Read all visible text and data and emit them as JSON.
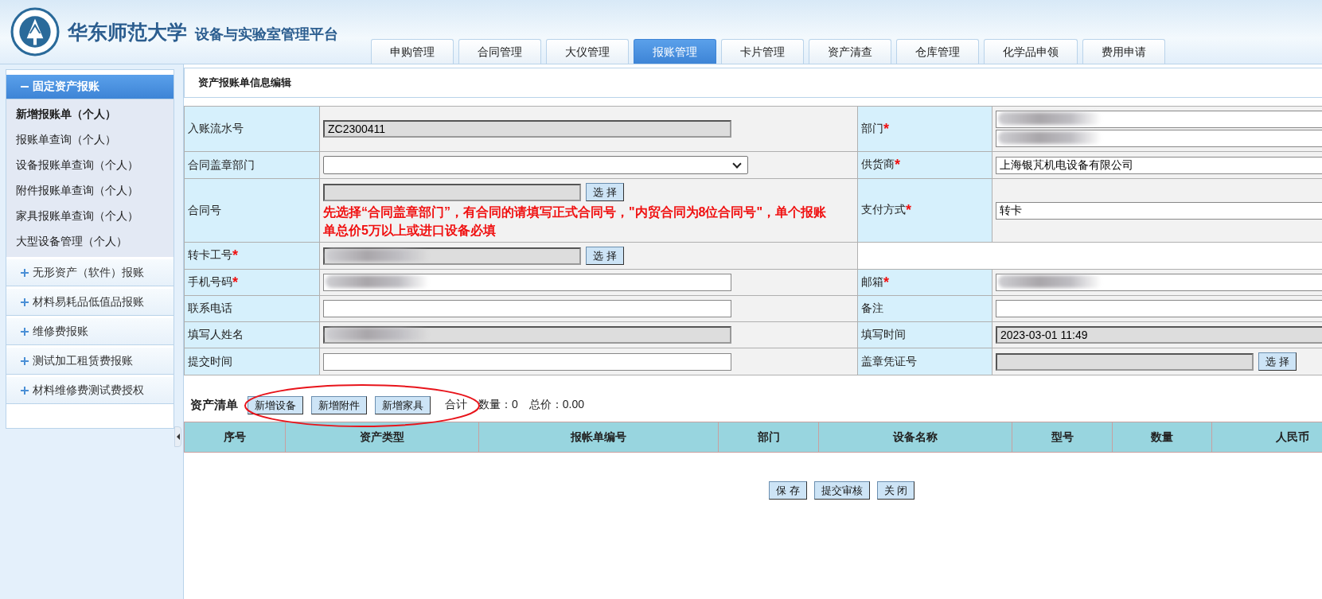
{
  "header": {
    "title": "华东师范大学",
    "subtitle": "设备与实验室管理平台"
  },
  "tabs": [
    {
      "label": "申购管理",
      "selected": false
    },
    {
      "label": "合同管理",
      "selected": false
    },
    {
      "label": "大仪管理",
      "selected": false
    },
    {
      "label": "报账管理",
      "selected": true
    },
    {
      "label": "卡片管理",
      "selected": false
    },
    {
      "label": "资产清查",
      "selected": false
    },
    {
      "label": "仓库管理",
      "selected": false
    },
    {
      "label": "化学品申领",
      "selected": false
    },
    {
      "label": "费用申请",
      "selected": false
    }
  ],
  "sidebar": {
    "groups": [
      {
        "label": "固定资产报账",
        "expanded": true,
        "items": [
          {
            "label": "新增报账单（个人）",
            "selected": true
          },
          {
            "label": "报账单查询（个人）",
            "selected": false
          },
          {
            "label": "设备报账单查询（个人）",
            "selected": false
          },
          {
            "label": "附件报账单查询（个人）",
            "selected": false
          },
          {
            "label": "家具报账单查询（个人）",
            "selected": false
          },
          {
            "label": "大型设备管理（个人）",
            "selected": false
          }
        ]
      },
      {
        "label": "无形资产（软件）报账",
        "expanded": false
      },
      {
        "label": "材料易耗品低值品报账",
        "expanded": false
      },
      {
        "label": "维修费报账",
        "expanded": false
      },
      {
        "label": "测试加工租赁费报账",
        "expanded": false
      },
      {
        "label": "材料维修费测试费授权",
        "expanded": false
      }
    ]
  },
  "panel_title": "资产报账单信息编辑",
  "form": {
    "rows": [
      {
        "cells": [
          {
            "label": "入账流水号",
            "controls": [
              {
                "kind": "input",
                "value": "ZC2300411",
                "readonly": true
              }
            ]
          },
          {
            "label": "部门",
            "mark": "*",
            "controls": [
              {
                "kind": "input",
                "redacted": true,
                "readonly": false
              },
              {
                "kind": "input",
                "redacted": true,
                "readonly": false
              }
            ]
          }
        ]
      },
      {
        "cells": [
          {
            "label": "合同盖章部门",
            "controls": [
              {
                "kind": "select"
              }
            ]
          },
          {
            "label": "供货商",
            "mark": "*",
            "controls": [
              {
                "kind": "input",
                "value": "上海银芃机电设备有限公司",
                "readonly": false
              }
            ]
          }
        ]
      },
      {
        "cells": [
          {
            "label": "合同号",
            "controls": [
              {
                "kind": "input",
                "readonly": true
              },
              {
                "kind": "button",
                "label": "选 择"
              },
              {
                "kind": "note",
                "text": "先选择“合同盖章部门”，有合同的请填写正式合同号，\"内贸合同为8位合同号\"，单个报账单总价5万以上或进口设备必填"
              }
            ]
          },
          {
            "label": "支付方式",
            "mark": "*",
            "controls": [
              {
                "kind": "input",
                "value": "转卡",
                "readonly": false
              }
            ]
          }
        ]
      },
      {
        "cells": [
          {
            "label": "转卡工号",
            "mark": "*",
            "controls": [
              {
                "kind": "input",
                "redacted": true,
                "readonly": true
              },
              {
                "kind": "button",
                "label": "选 择"
              }
            ]
          },
          {
            "kind": "blank"
          }
        ]
      },
      {
        "cells": [
          {
            "label": "手机号码",
            "mark": "*",
            "controls": [
              {
                "kind": "input",
                "redacted": true,
                "readonly": false
              }
            ]
          },
          {
            "label": "邮箱",
            "mark": "*",
            "controls": [
              {
                "kind": "input",
                "redacted": true,
                "readonly": false
              }
            ]
          }
        ]
      },
      {
        "cells": [
          {
            "label": "联系电话",
            "controls": [
              {
                "kind": "input",
                "readonly": false
              }
            ]
          },
          {
            "label": "备注",
            "controls": [
              {
                "kind": "input",
                "readonly": false
              }
            ]
          }
        ]
      },
      {
        "cells": [
          {
            "label": "填写人姓名",
            "controls": [
              {
                "kind": "input",
                "redacted": true,
                "readonly": true
              }
            ]
          },
          {
            "label": "填写时间",
            "controls": [
              {
                "kind": "input",
                "value": "2023-03-01 11:49",
                "readonly": true
              }
            ]
          }
        ]
      },
      {
        "cells": [
          {
            "label": "提交时间",
            "controls": [
              {
                "kind": "input",
                "readonly": false
              }
            ]
          },
          {
            "label": "盖章凭证号",
            "controls": [
              {
                "kind": "input",
                "readonly": true
              },
              {
                "kind": "button",
                "label": "选 择"
              }
            ]
          }
        ]
      }
    ]
  },
  "asset_list": {
    "title": "资产清单",
    "buttons": [
      "新增设备",
      "新增附件",
      "新增家具"
    ],
    "summary": [
      "合计",
      "数量：0",
      "总价：0.00"
    ],
    "highlight": {
      "kind": "ellipse"
    },
    "columns": [
      "序号",
      "资产类型",
      "报帐单编号",
      "部门",
      "设备名称",
      "型号",
      "数量",
      "人民币"
    ]
  },
  "actions": [
    "保 存",
    "提交审核",
    "关 闭"
  ]
}
